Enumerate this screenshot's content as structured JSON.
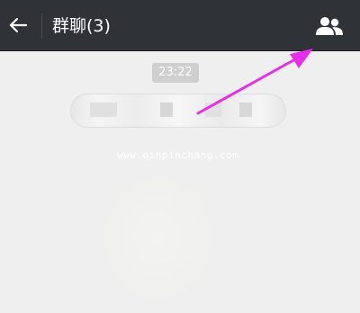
{
  "header": {
    "title": "群聊(3)",
    "back_icon": "arrow-left-icon",
    "members_icon": "group-members-icon",
    "background": "#2f3236"
  },
  "chat": {
    "timestamp": "23:22",
    "system_message": ""
  },
  "watermark": {
    "text": "www.qinpinchang.com"
  },
  "annotation": {
    "type": "arrow",
    "color": "#e62ee8"
  }
}
